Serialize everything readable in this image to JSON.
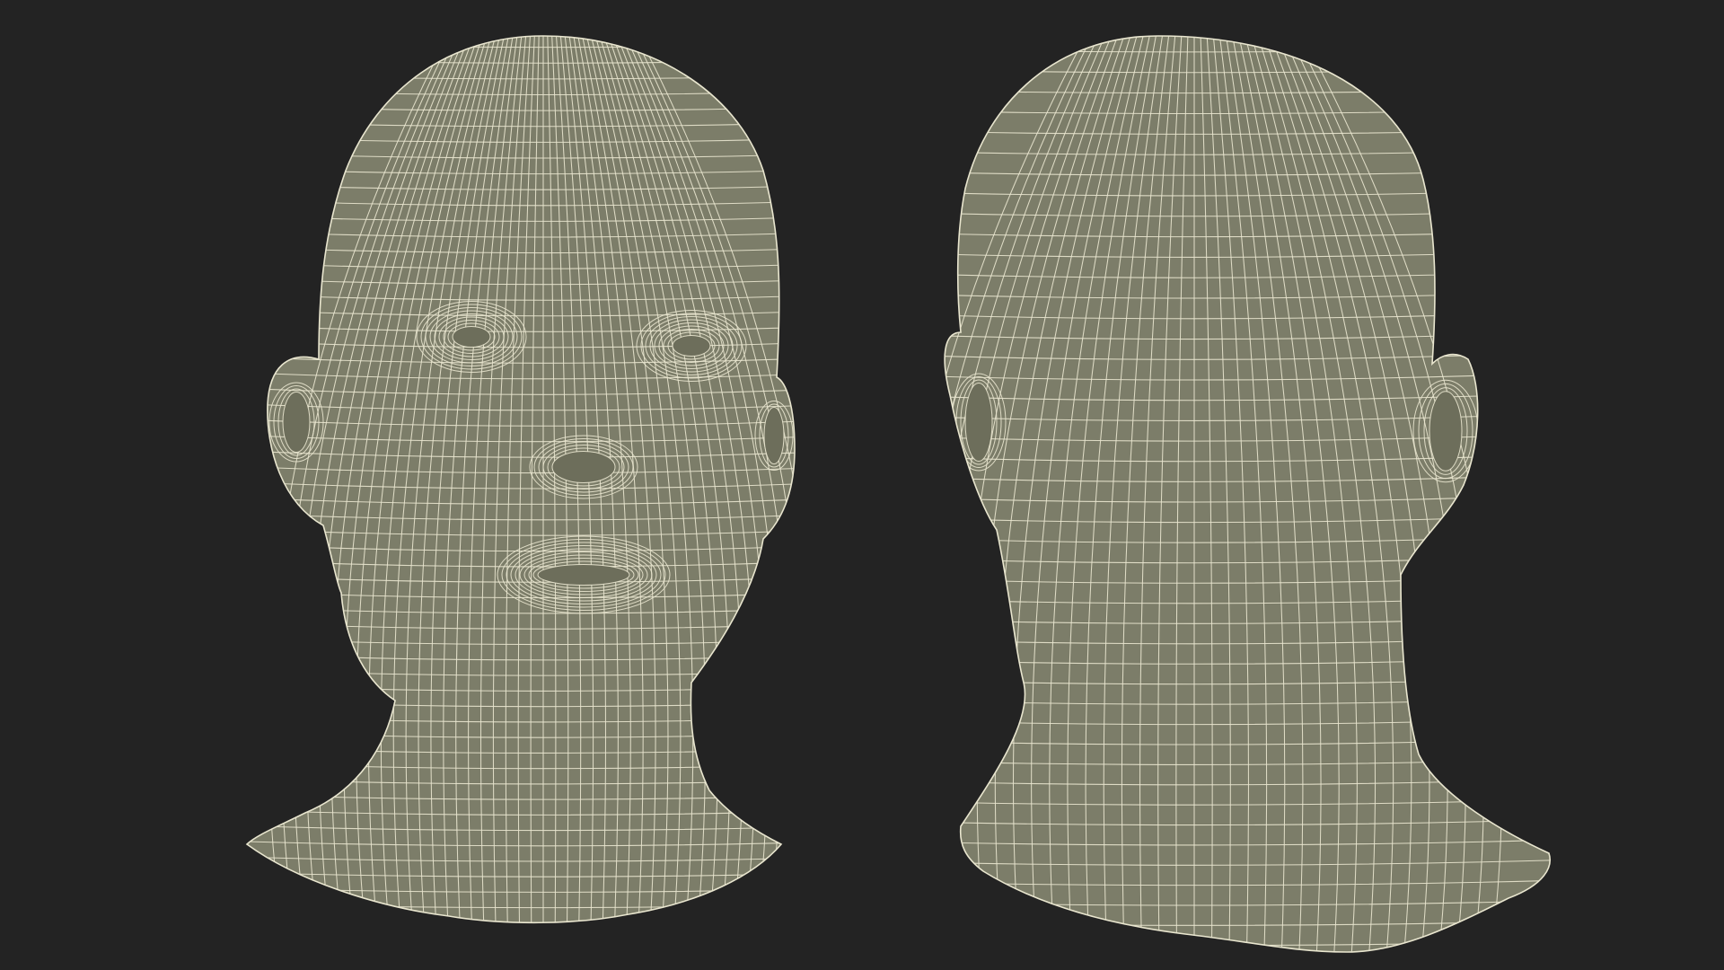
{
  "scene": {
    "background_color": "#232323",
    "mesh_fill_color": "#7c7d69",
    "mesh_shade_color": "#6d6e5b",
    "wire_color": "#e9e6cf",
    "views": [
      {
        "name": "front-view",
        "icon": "head-front-wireframe"
      },
      {
        "name": "back-view",
        "icon": "head-back-wireframe"
      }
    ]
  }
}
